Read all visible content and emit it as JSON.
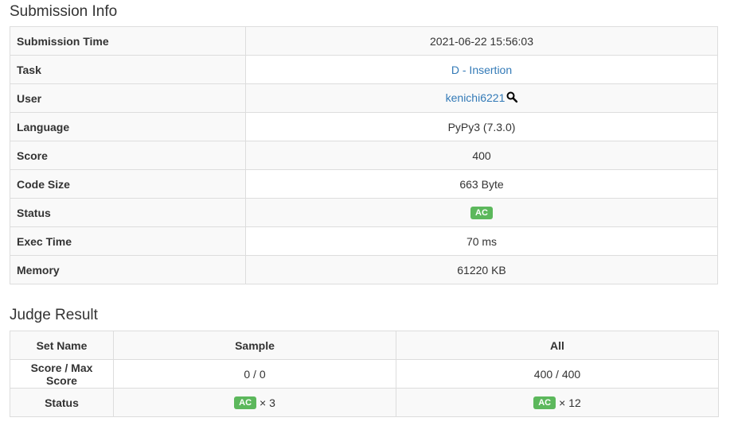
{
  "submission": {
    "title": "Submission Info",
    "rows": [
      {
        "label": "Submission Time",
        "value": "2021-06-22 15:56:03"
      },
      {
        "label": "Task",
        "value": "D - Insertion"
      },
      {
        "label": "User",
        "value": "kenichi6221"
      },
      {
        "label": "Language",
        "value": "PyPy3 (7.3.0)"
      },
      {
        "label": "Score",
        "value": "400"
      },
      {
        "label": "Code Size",
        "value": "663 Byte"
      },
      {
        "label": "Status",
        "value": "AC"
      },
      {
        "label": "Exec Time",
        "value": "70 ms"
      },
      {
        "label": "Memory",
        "value": "61220 KB"
      }
    ]
  },
  "judge": {
    "title": "Judge Result",
    "headers": [
      "Set Name",
      "Sample",
      "All"
    ],
    "score_row": {
      "label": "Score / Max Score",
      "sample": "0 / 0",
      "all": "400 / 400"
    },
    "status_row": {
      "label": "Status",
      "sample_badge": "AC",
      "sample_count": "× 3",
      "all_badge": "AC",
      "all_count": "× 12"
    }
  },
  "colors": {
    "link": "#337ab7",
    "ac_badge": "#5cb85c",
    "border": "#dddddd",
    "stripe": "#f9f9f9"
  },
  "icons": {
    "user_search": "search-icon"
  }
}
